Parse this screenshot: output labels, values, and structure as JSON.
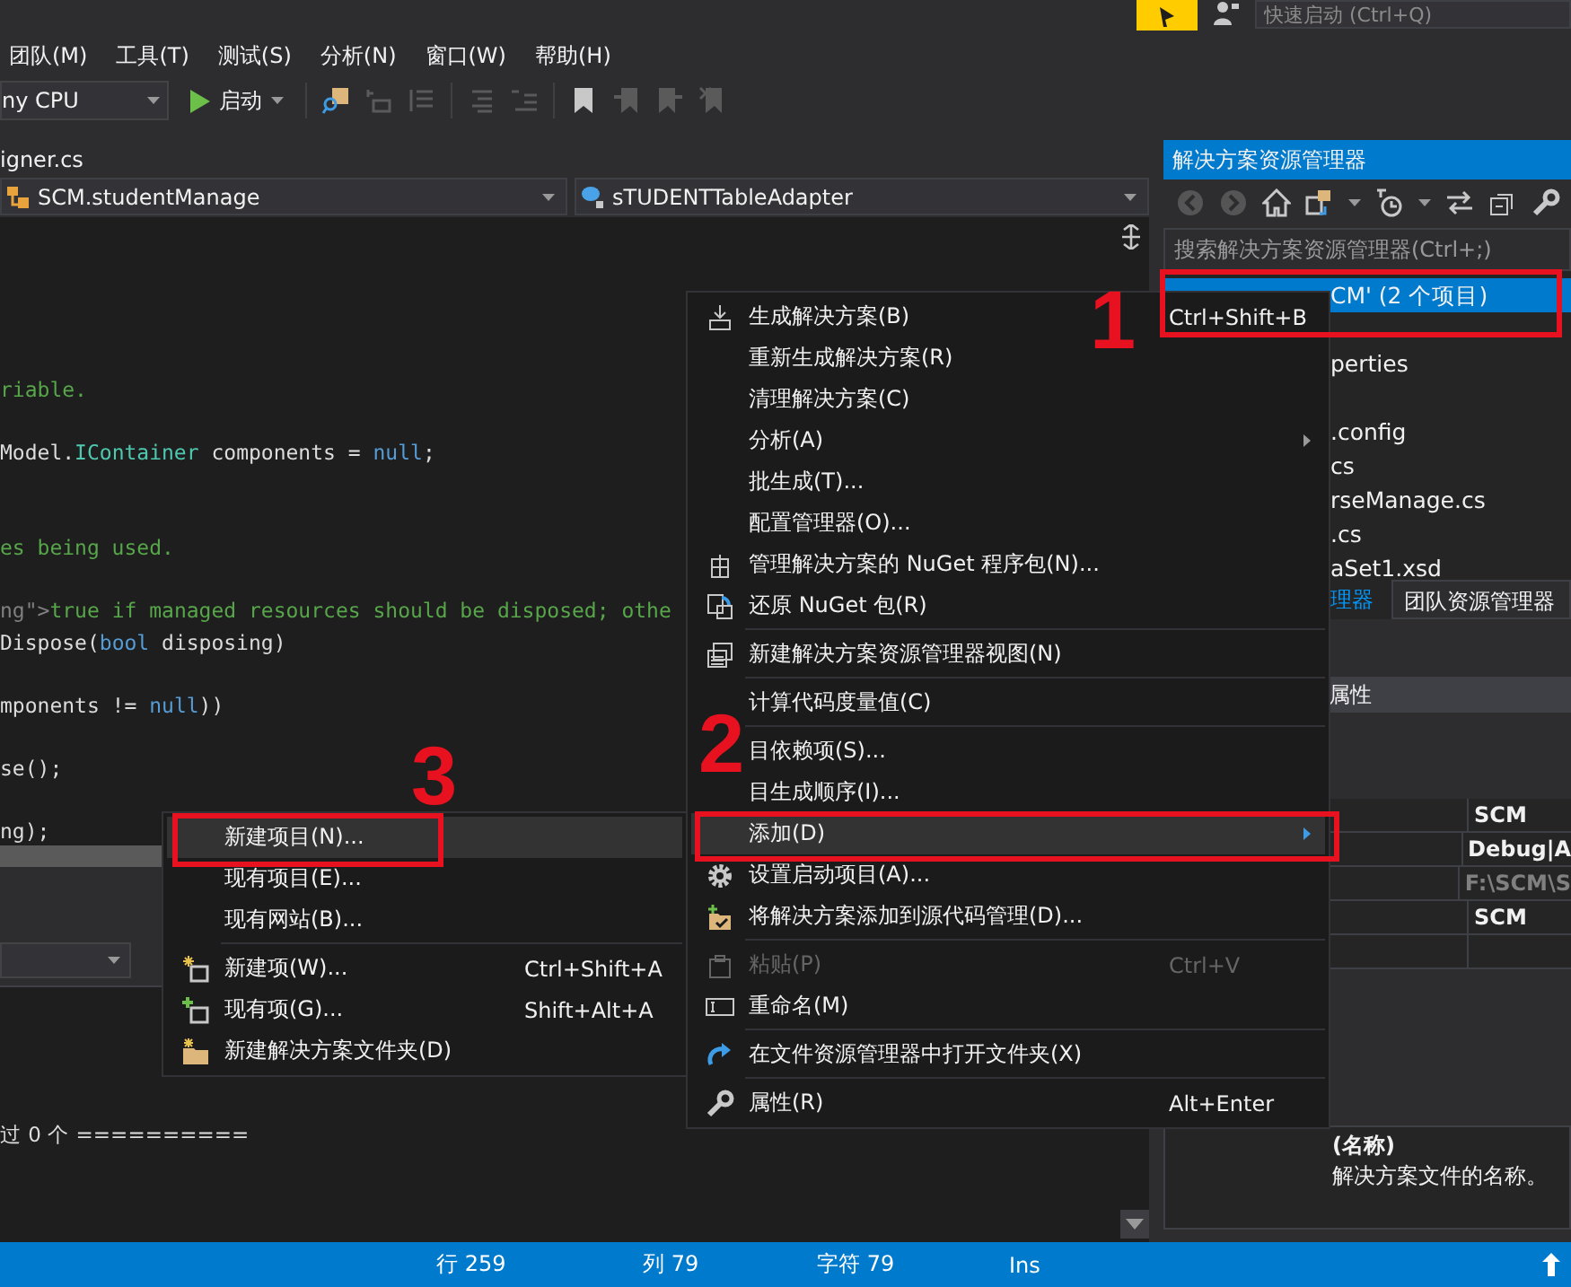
{
  "title_bar": {
    "quick_launch": {
      "placeholder": "快速启动 (Ctrl+Q)"
    }
  },
  "menu_bar": [
    "团队(M)",
    "工具(T)",
    "测试(S)",
    "分析(N)",
    "窗口(W)",
    "帮助(H)"
  ],
  "toolbar": {
    "platform": "ny CPU",
    "start": "启动"
  },
  "editor": {
    "tab": "igner.cs",
    "nav_left": "SCM.studentManage",
    "nav_right": "sTUDENTTableAdapter",
    "lines": [
      {
        "kind": "blank"
      },
      {
        "kind": "blank"
      },
      {
        "kind": "blank"
      },
      {
        "kind": "blank"
      },
      {
        "kind": "blank"
      },
      {
        "kind": "code",
        "tokens": [
          {
            "text": "riable.",
            "kind": "comment"
          }
        ]
      },
      {
        "kind": "blank"
      },
      {
        "kind": "code",
        "tokens": [
          {
            "text": "Model.",
            "kind": "plain"
          },
          {
            "text": "IContainer",
            "kind": "type"
          },
          {
            "text": " components = ",
            "kind": "plain"
          },
          {
            "text": "null",
            "kind": "keyword"
          },
          {
            "text": ";",
            "kind": "plain"
          }
        ]
      },
      {
        "kind": "blank"
      },
      {
        "kind": "blank"
      },
      {
        "kind": "code",
        "tokens": [
          {
            "text": "es being used.",
            "kind": "comment"
          }
        ]
      },
      {
        "kind": "blank"
      },
      {
        "kind": "code",
        "tokens": [
          {
            "text": "ng\">",
            "kind": "doc_tag"
          },
          {
            "text": "true if managed resources should be disposed; othe",
            "kind": "comment"
          }
        ]
      },
      {
        "kind": "code",
        "tokens": [
          {
            "text": "Dispose(",
            "kind": "plain"
          },
          {
            "text": "bool",
            "kind": "keyword"
          },
          {
            "text": " disposing)",
            "kind": "plain"
          }
        ]
      },
      {
        "kind": "blank"
      },
      {
        "kind": "code",
        "tokens": [
          {
            "text": "mponents != ",
            "kind": "plain"
          },
          {
            "text": "null",
            "kind": "keyword"
          },
          {
            "text": "))",
            "kind": "plain"
          }
        ]
      },
      {
        "kind": "blank"
      },
      {
        "kind": "code",
        "tokens": [
          {
            "text": "se();",
            "kind": "plain"
          }
        ]
      },
      {
        "kind": "blank"
      },
      {
        "kind": "code",
        "tokens": [
          {
            "text": "ng);",
            "kind": "plain"
          }
        ]
      }
    ],
    "output": "过 0 个 =========="
  },
  "solution_explorer": {
    "title": "解决方案资源管理器",
    "search": {
      "placeholder": "搜索解决方案资源管理器(Ctrl+;)"
    },
    "items": [
      {
        "kind": "row",
        "label": "CM' (2 个项目)",
        "selected": true
      },
      {
        "kind": "covered"
      },
      {
        "kind": "row",
        "label": "perties",
        "selected": false
      },
      {
        "kind": "covered"
      },
      {
        "kind": "row",
        "label": ".config",
        "selected": false
      },
      {
        "kind": "row",
        "label": "cs",
        "selected": false
      },
      {
        "kind": "row",
        "label": "rseManage.cs",
        "selected": false
      },
      {
        "kind": "row",
        "label": ".cs",
        "selected": false
      },
      {
        "kind": "row",
        "label": "aSet1.xsd",
        "selected": false
      }
    ],
    "tabs": [
      {
        "label": "理器",
        "selected": true
      },
      {
        "label": "团队资源管理器",
        "selected": false
      }
    ]
  },
  "properties": {
    "title": "属性",
    "values": [
      {
        "text": "SCM",
        "disabled": false
      },
      {
        "text": "Debug|A",
        "disabled": false
      },
      {
        "text": "F:\\SCM\\S",
        "disabled": true
      },
      {
        "text": "SCM",
        "disabled": false
      }
    ],
    "description_title": "(名称)",
    "description": "解决方案文件的名称。"
  },
  "status_bar": [
    "行 259",
    "列 79",
    "字符 79",
    "Ins"
  ],
  "context_menu": [
    {
      "kind": "item",
      "label": "生成解决方案(B)",
      "shortcut": "Ctrl+Shift+B",
      "has_submenu": false,
      "selected": false,
      "disabled": false
    },
    {
      "kind": "item",
      "label": "重新生成解决方案(R)",
      "has_submenu": false,
      "selected": false,
      "disabled": false
    },
    {
      "kind": "item",
      "label": "清理解决方案(C)",
      "has_submenu": false,
      "selected": false,
      "disabled": false
    },
    {
      "kind": "item",
      "label": "分析(A)",
      "has_submenu": true,
      "selected": false,
      "disabled": false
    },
    {
      "kind": "item",
      "label": "批生成(T)...",
      "has_submenu": false,
      "selected": false,
      "disabled": false
    },
    {
      "kind": "item",
      "label": "配置管理器(O)...",
      "has_submenu": false,
      "selected": false,
      "disabled": false
    },
    {
      "kind": "item",
      "label": "管理解决方案的 NuGet 程序包(N)...",
      "has_submenu": false,
      "selected": false,
      "disabled": false
    },
    {
      "kind": "item",
      "label": "还原 NuGet 包(R)",
      "has_submenu": false,
      "selected": false,
      "disabled": false
    },
    {
      "kind": "separator"
    },
    {
      "kind": "item",
      "label": "新建解决方案资源管理器视图(N)",
      "has_submenu": false,
      "selected": false,
      "disabled": false
    },
    {
      "kind": "separator"
    },
    {
      "kind": "item",
      "label": "计算代码度量值(C)",
      "has_submenu": false,
      "selected": false,
      "disabled": false
    },
    {
      "kind": "separator"
    },
    {
      "kind": "item",
      "label": "目依赖项(S)...",
      "has_submenu": false,
      "selected": false,
      "disabled": false
    },
    {
      "kind": "item",
      "label": "目生成顺序(I)...",
      "has_submenu": false,
      "selected": false,
      "disabled": false
    },
    {
      "kind": "item",
      "label": "添加(D)",
      "has_submenu": true,
      "selected": true,
      "disabled": false
    },
    {
      "kind": "item",
      "label": "设置启动项目(A)...",
      "has_submenu": false,
      "selected": false,
      "disabled": false
    },
    {
      "kind": "item",
      "label": "将解决方案添加到源代码管理(D)...",
      "has_submenu": false,
      "selected": false,
      "disabled": false
    },
    {
      "kind": "separator"
    },
    {
      "kind": "item",
      "label": "粘贴(P)",
      "shortcut": "Ctrl+V",
      "has_submenu": false,
      "selected": false,
      "disabled": true
    },
    {
      "kind": "item",
      "label": "重命名(M)",
      "has_submenu": false,
      "selected": false,
      "disabled": false
    },
    {
      "kind": "separator"
    },
    {
      "kind": "item",
      "label": "在文件资源管理器中打开文件夹(X)",
      "has_submenu": false,
      "selected": false,
      "disabled": false
    },
    {
      "kind": "separator"
    },
    {
      "kind": "item",
      "label": "属性(R)",
      "shortcut": "Alt+Enter",
      "has_submenu": false,
      "selected": false,
      "disabled": false
    }
  ],
  "submenu": [
    {
      "kind": "item",
      "label": "新建项目(N)...",
      "selected": true,
      "disabled": false
    },
    {
      "kind": "item",
      "label": "现有项目(E)...",
      "selected": false,
      "disabled": false
    },
    {
      "kind": "item",
      "label": "现有网站(B)...",
      "selected": false,
      "disabled": false
    },
    {
      "kind": "separator"
    },
    {
      "kind": "item",
      "label": "新建项(W)...",
      "shortcut": "Ctrl+Shift+A",
      "selected": false,
      "disabled": false
    },
    {
      "kind": "item",
      "label": "现有项(G)...",
      "shortcut": "Shift+Alt+A",
      "selected": false,
      "disabled": false
    },
    {
      "kind": "item",
      "label": "新建解决方案文件夹(D)",
      "selected": false,
      "disabled": false
    }
  ],
  "annotations": [
    {
      "number": "1"
    },
    {
      "number": "2"
    },
    {
      "number": "3"
    }
  ]
}
